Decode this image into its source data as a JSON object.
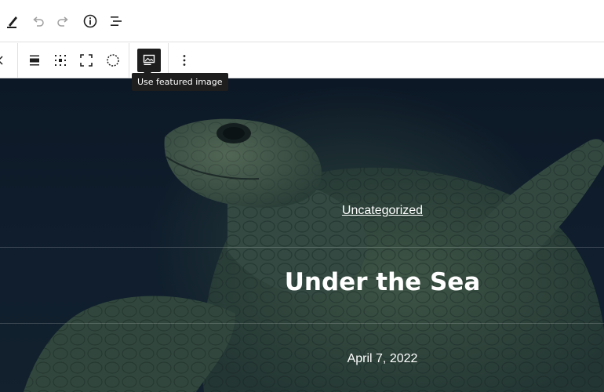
{
  "toolbar": {
    "icons": [
      "pencil-icon",
      "undo-icon",
      "redo-icon",
      "info-icon",
      "list-view-icon"
    ]
  },
  "block_toolbar": {
    "icons": [
      "align-icon",
      "content-position-icon",
      "full-height-icon",
      "duotone-icon",
      "featured-image-icon",
      "more-options-icon"
    ]
  },
  "tooltip": {
    "text": "Use featured image"
  },
  "cover": {
    "category": "Uncategorized",
    "title": "Under the Sea",
    "date": "April 7, 2022"
  },
  "colors": {
    "toolbar_bg": "#ffffff",
    "icon": "#1e1e1e",
    "icon_disabled": "#a0a0a0",
    "active_button_bg": "#1e1e1e",
    "cover_overlay": "#0f1d2b",
    "cover_text": "#ffffff"
  }
}
